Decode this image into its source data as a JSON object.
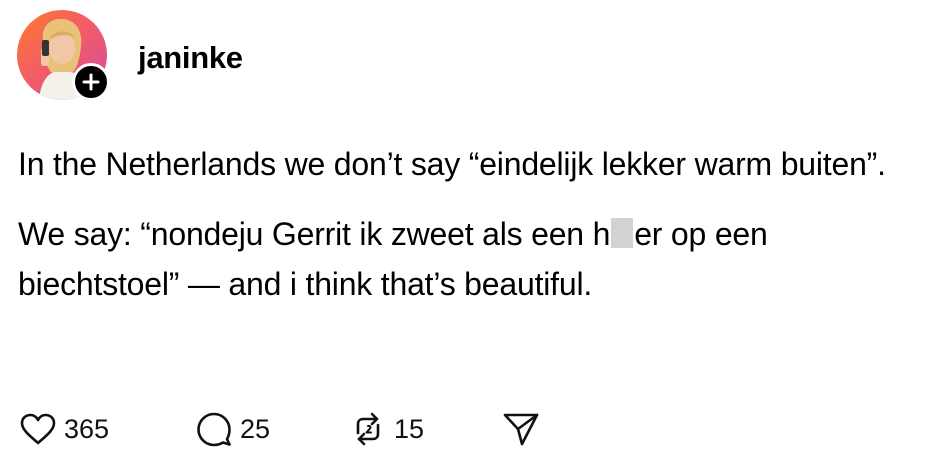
{
  "post": {
    "author": {
      "username": "janinke",
      "avatar_icon": "avatar-photo",
      "follow_icon": "plus-icon"
    },
    "text": {
      "paragraph_1": "In the Netherlands we don’t say “eindelijk lekker warm buiten”.",
      "paragraph_2_before": "We say: “nondeju Gerrit ik zweet als een h",
      "paragraph_2_after": "er op een biechtstoel” — and i think that’s beautiful."
    },
    "actions": {
      "likes": "365",
      "replies": "25",
      "reposts": "15",
      "like_icon": "heart-icon",
      "reply_icon": "speech-bubble-icon",
      "repost_icon": "repost-icon",
      "share_icon": "send-icon"
    }
  }
}
